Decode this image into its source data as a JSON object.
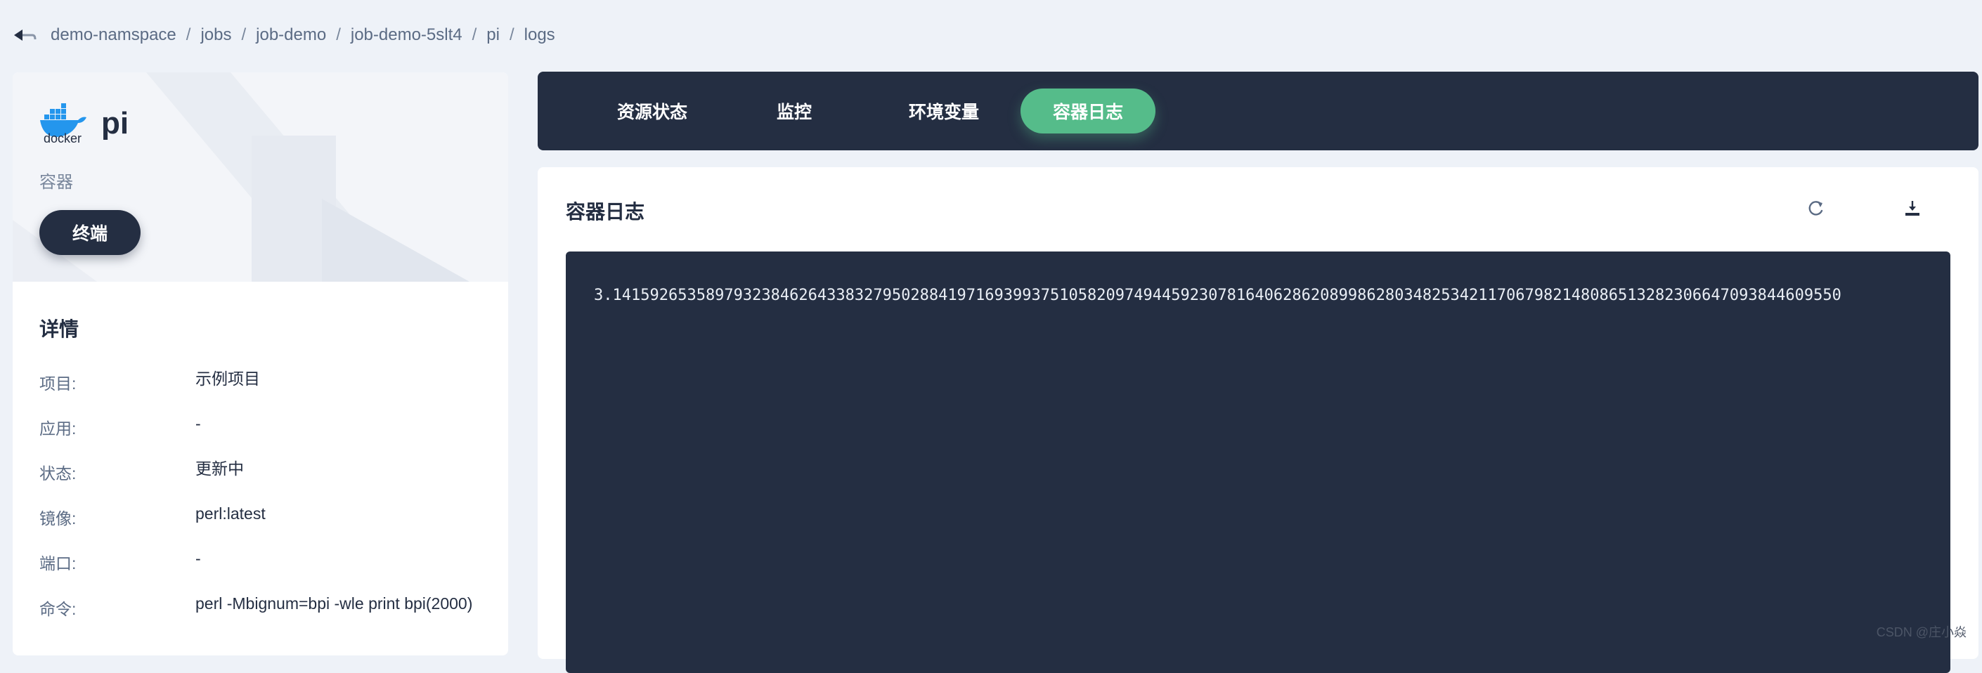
{
  "breadcrumb": {
    "items": [
      "demo-namspace",
      "jobs",
      "job-demo",
      "job-demo-5slt4",
      "pi",
      "logs"
    ],
    "separator": "/"
  },
  "container": {
    "logo_text": "docker",
    "name": "pi",
    "type": "容器",
    "terminal_label": "终端"
  },
  "details": {
    "title": "详情",
    "rows": [
      {
        "key": "项目:",
        "value": "示例项目"
      },
      {
        "key": "应用:",
        "value": "-"
      },
      {
        "key": "状态:",
        "value": "更新中"
      },
      {
        "key": "镜像:",
        "value": "perl:latest"
      },
      {
        "key": "端口:",
        "value": "-"
      },
      {
        "key": "命令:",
        "value": "perl -Mbignum=bpi -wle print bpi(2000)"
      }
    ]
  },
  "tabs": [
    {
      "label": "资源状态",
      "active": false
    },
    {
      "label": "监控",
      "active": false
    },
    {
      "label": "环境变量",
      "active": false
    },
    {
      "label": "容器日志",
      "active": true
    }
  ],
  "logs": {
    "title": "容器日志",
    "refresh_icon": "refresh-icon",
    "download_icon": "download-icon",
    "content": "3.141592653589793238462643383279502884197169399375105820974944592307816406286208998628034825342117067982148086513282306647093844609550"
  },
  "watermark": "CSDN @庄小焱",
  "colors": {
    "dark": "#242e42",
    "accent": "#55bc8a",
    "page_bg": "#eef2f8",
    "docker_blue": "#2496ed"
  }
}
